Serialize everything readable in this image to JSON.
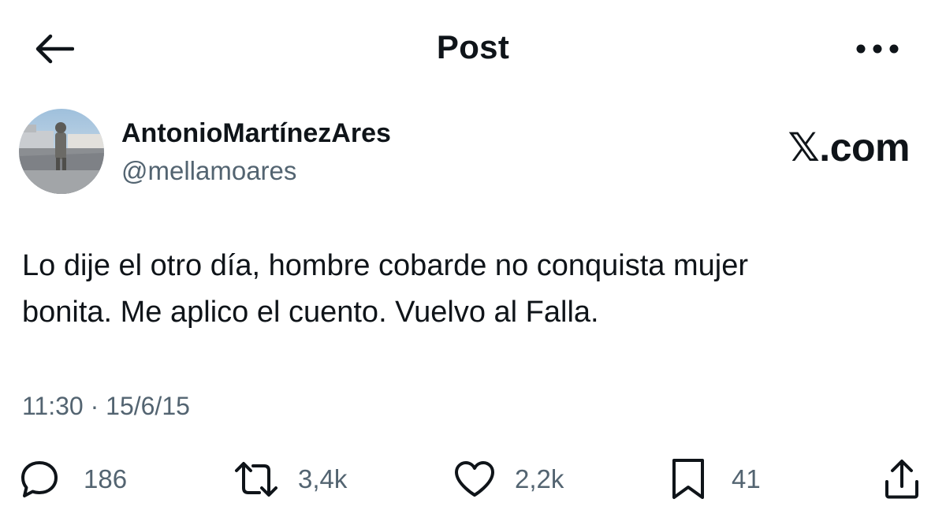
{
  "header": {
    "title": "Post",
    "back_icon": "arrow-left-icon",
    "more_icon": "more-horizontal-icon"
  },
  "author": {
    "display_name": "AntonioMartínezAres",
    "handle": "@mellamoares",
    "avatar_icon": "avatar-photo",
    "brand": "𝕏.com"
  },
  "post": {
    "text": "Lo dije el otro día, hombre cobarde no conquista mujer\nbonita. Me aplico el cuento. Vuelvo al Falla.",
    "timestamp": "11:30 · 15/6/15"
  },
  "actions": {
    "replies": "186",
    "reposts": "3,4k",
    "likes": "2,2k",
    "bookmarks": "41",
    "reply_icon": "reply-bubble-icon",
    "repost_icon": "repost-icon",
    "like_icon": "heart-icon",
    "bookmark_icon": "bookmark-icon",
    "share_icon": "share-icon"
  },
  "colors": {
    "text_primary": "#0f1419",
    "text_secondary": "#536471",
    "background": "#ffffff"
  }
}
